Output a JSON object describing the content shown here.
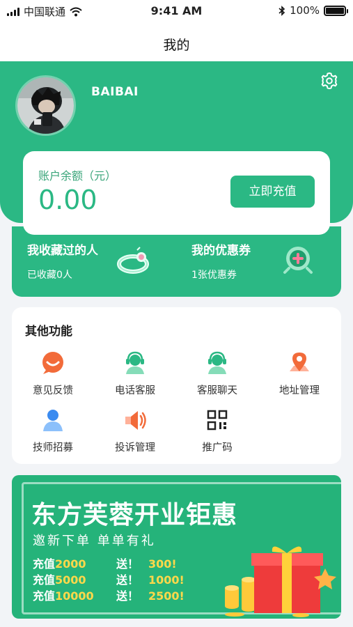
{
  "status_bar": {
    "carrier": "中国联通",
    "time": "9:41 AM",
    "battery": "100%"
  },
  "nav": {
    "title": "我的"
  },
  "profile": {
    "username": "BAIBAI"
  },
  "balance": {
    "label": "账户余额（元）",
    "value": "0.00",
    "button": "立即充值"
  },
  "stats": [
    {
      "title": "我收藏过的人",
      "sub": "已收藏0人",
      "icon": "ring-icon"
    },
    {
      "title": "我的优惠券",
      "sub": "1张优惠券",
      "icon": "coupon-icon"
    }
  ],
  "functions": {
    "title": "其他功能",
    "items": [
      {
        "label": "意见反馈",
        "icon": "feedback-icon"
      },
      {
        "label": "电话客服",
        "icon": "phone-service-icon"
      },
      {
        "label": "客服聊天",
        "icon": "chat-service-icon"
      },
      {
        "label": "地址管理",
        "icon": "location-icon"
      },
      {
        "label": "技师招募",
        "icon": "recruit-icon"
      },
      {
        "label": "投诉管理",
        "icon": "speaker-icon"
      },
      {
        "label": "推广码",
        "icon": "qrcode-icon"
      }
    ]
  },
  "banner": {
    "title": "东方芙蓉开业钜惠",
    "subtitle": "邀新下单 单单有礼",
    "promos": [
      {
        "charge": "充值",
        "amount": "2000",
        "gift": "送！",
        "bonus": "300!"
      },
      {
        "charge": "充值",
        "amount": "5000",
        "gift": "送！",
        "bonus": "1000!"
      },
      {
        "charge": "充值",
        "amount": "10000",
        "gift": "送！",
        "bonus": "2500!"
      }
    ]
  },
  "colors": {
    "brand_green": "#2bb884",
    "promo_yellow": "#ffd84a",
    "accent_orange": "#f26b3a"
  }
}
